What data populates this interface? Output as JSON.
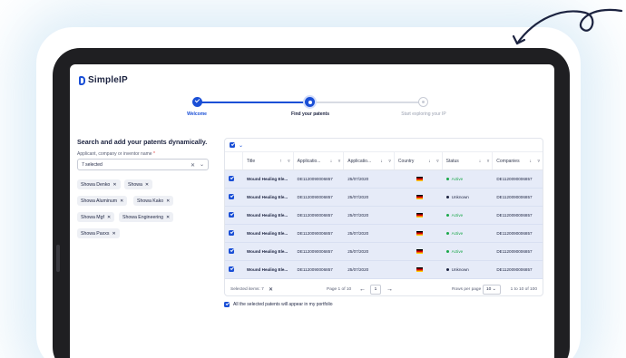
{
  "app": {
    "name": "SimpleIP"
  },
  "colors": {
    "primary": "#1a4fd6",
    "active": "#1aa84a",
    "unknown": "#1c2340",
    "row_bg": "#e6ebf8"
  },
  "stepper": {
    "steps": [
      {
        "label": "Welcome",
        "state": "done"
      },
      {
        "label": "Find your patents",
        "state": "active"
      },
      {
        "label": "Start exploring your IP",
        "state": "todo"
      }
    ]
  },
  "search": {
    "heading": "Search and add your patents dynamically.",
    "field_label": "Applicant, company or inventor name",
    "required_mark": "*",
    "value": "7 selected",
    "chips": [
      "Showa Denko",
      "Showa",
      "Showa Aluminum",
      "Showa Kako",
      "Showa Mgf",
      "Showa Engineering",
      "Showa Paxxs"
    ]
  },
  "table": {
    "columns": [
      "Title",
      "Applicatio...",
      "Applicatio...",
      "Country",
      "Status",
      "Companies"
    ],
    "rows": [
      {
        "title": "Wound Healing Ele...",
        "app_no": "DE1120090006857",
        "app_date": "25/07/2020",
        "country": "DE",
        "status": "Active",
        "company": "DE1120090006857"
      },
      {
        "title": "Wound Healing Ele...",
        "app_no": "DE1120090006857",
        "app_date": "25/07/2020",
        "country": "DE",
        "status": "Unknown",
        "company": "DE1120090006857"
      },
      {
        "title": "Wound Healing Ele...",
        "app_no": "DE1120090006857",
        "app_date": "25/07/2020",
        "country": "DE",
        "status": "Active",
        "company": "DE1120090006857"
      },
      {
        "title": "Wound Healing Ele...",
        "app_no": "DE1120090006857",
        "app_date": "25/07/2020",
        "country": "DE",
        "status": "Active",
        "company": "DE1120090006857"
      },
      {
        "title": "Wound Healing Ele...",
        "app_no": "DE1120090006857",
        "app_date": "25/07/2020",
        "country": "DE",
        "status": "Active",
        "company": "DE1120090006857"
      },
      {
        "title": "Wound Healing Ele...",
        "app_no": "DE1120090006857",
        "app_date": "25/07/2020",
        "country": "DE",
        "status": "Unknown",
        "company": "DE1120090006857"
      }
    ],
    "footer": {
      "selected_items": "Selected items: 7",
      "page_of": "Page 1 of 10",
      "page_value": "1",
      "rows_per_page_label": "Rows per page",
      "rows_per_page_value": "10",
      "range": "1 to 10 of 100"
    }
  },
  "portfolio_note": "All the selected patents will appear in my portfolio"
}
